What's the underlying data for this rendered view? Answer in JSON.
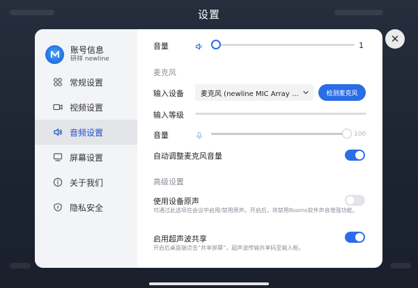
{
  "page": {
    "title": "设置"
  },
  "account": {
    "name": "账号信息",
    "subtitle": "研祥 newline"
  },
  "sidebar": {
    "items": [
      {
        "label": "常规设置",
        "icon": "grid-icon"
      },
      {
        "label": "视频设置",
        "icon": "camera-icon"
      },
      {
        "label": "音频设置",
        "icon": "speaker-icon",
        "active": true
      },
      {
        "label": "屏幕设置",
        "icon": "monitor-icon"
      },
      {
        "label": "关于我们",
        "icon": "info-icon"
      },
      {
        "label": "隐私安全",
        "icon": "shield-icon"
      }
    ]
  },
  "speaker": {
    "volume_label": "音量",
    "volume_value": "1",
    "volume_fraction": 0.0
  },
  "mic": {
    "section": "麦克风",
    "input_device_label": "输入设备",
    "input_device_value": "麦克风 (newline MIC Array & ...",
    "test_button": "检测麦克风",
    "input_level_label": "输入等级",
    "input_level_fraction": 0.0,
    "volume_label": "音量",
    "volume_value": "100",
    "volume_fraction": 1.0,
    "auto_adjust_label": "自动调整麦克风音量",
    "auto_adjust_on": true
  },
  "advanced": {
    "section": "高级设置",
    "original_sound_label": "使用设备原声",
    "original_sound_hint": "可通过此选项在会议中启用/禁用原声。开启后，将禁用Rooms软件声音增强功能。",
    "original_sound_on": false,
    "ultrasonic_label": "启用超声波共享",
    "ultrasonic_hint": "开启后桌面端点击“共享屏幕”，超声波传输共享码至输入框。",
    "ultrasonic_on": true
  },
  "colors": {
    "accent": "#2a6de6",
    "sidebar_bg": "#f3f4f6",
    "active_bg": "#e4e5e8"
  },
  "close": {
    "icon": "close-icon",
    "glyph": "✕"
  }
}
